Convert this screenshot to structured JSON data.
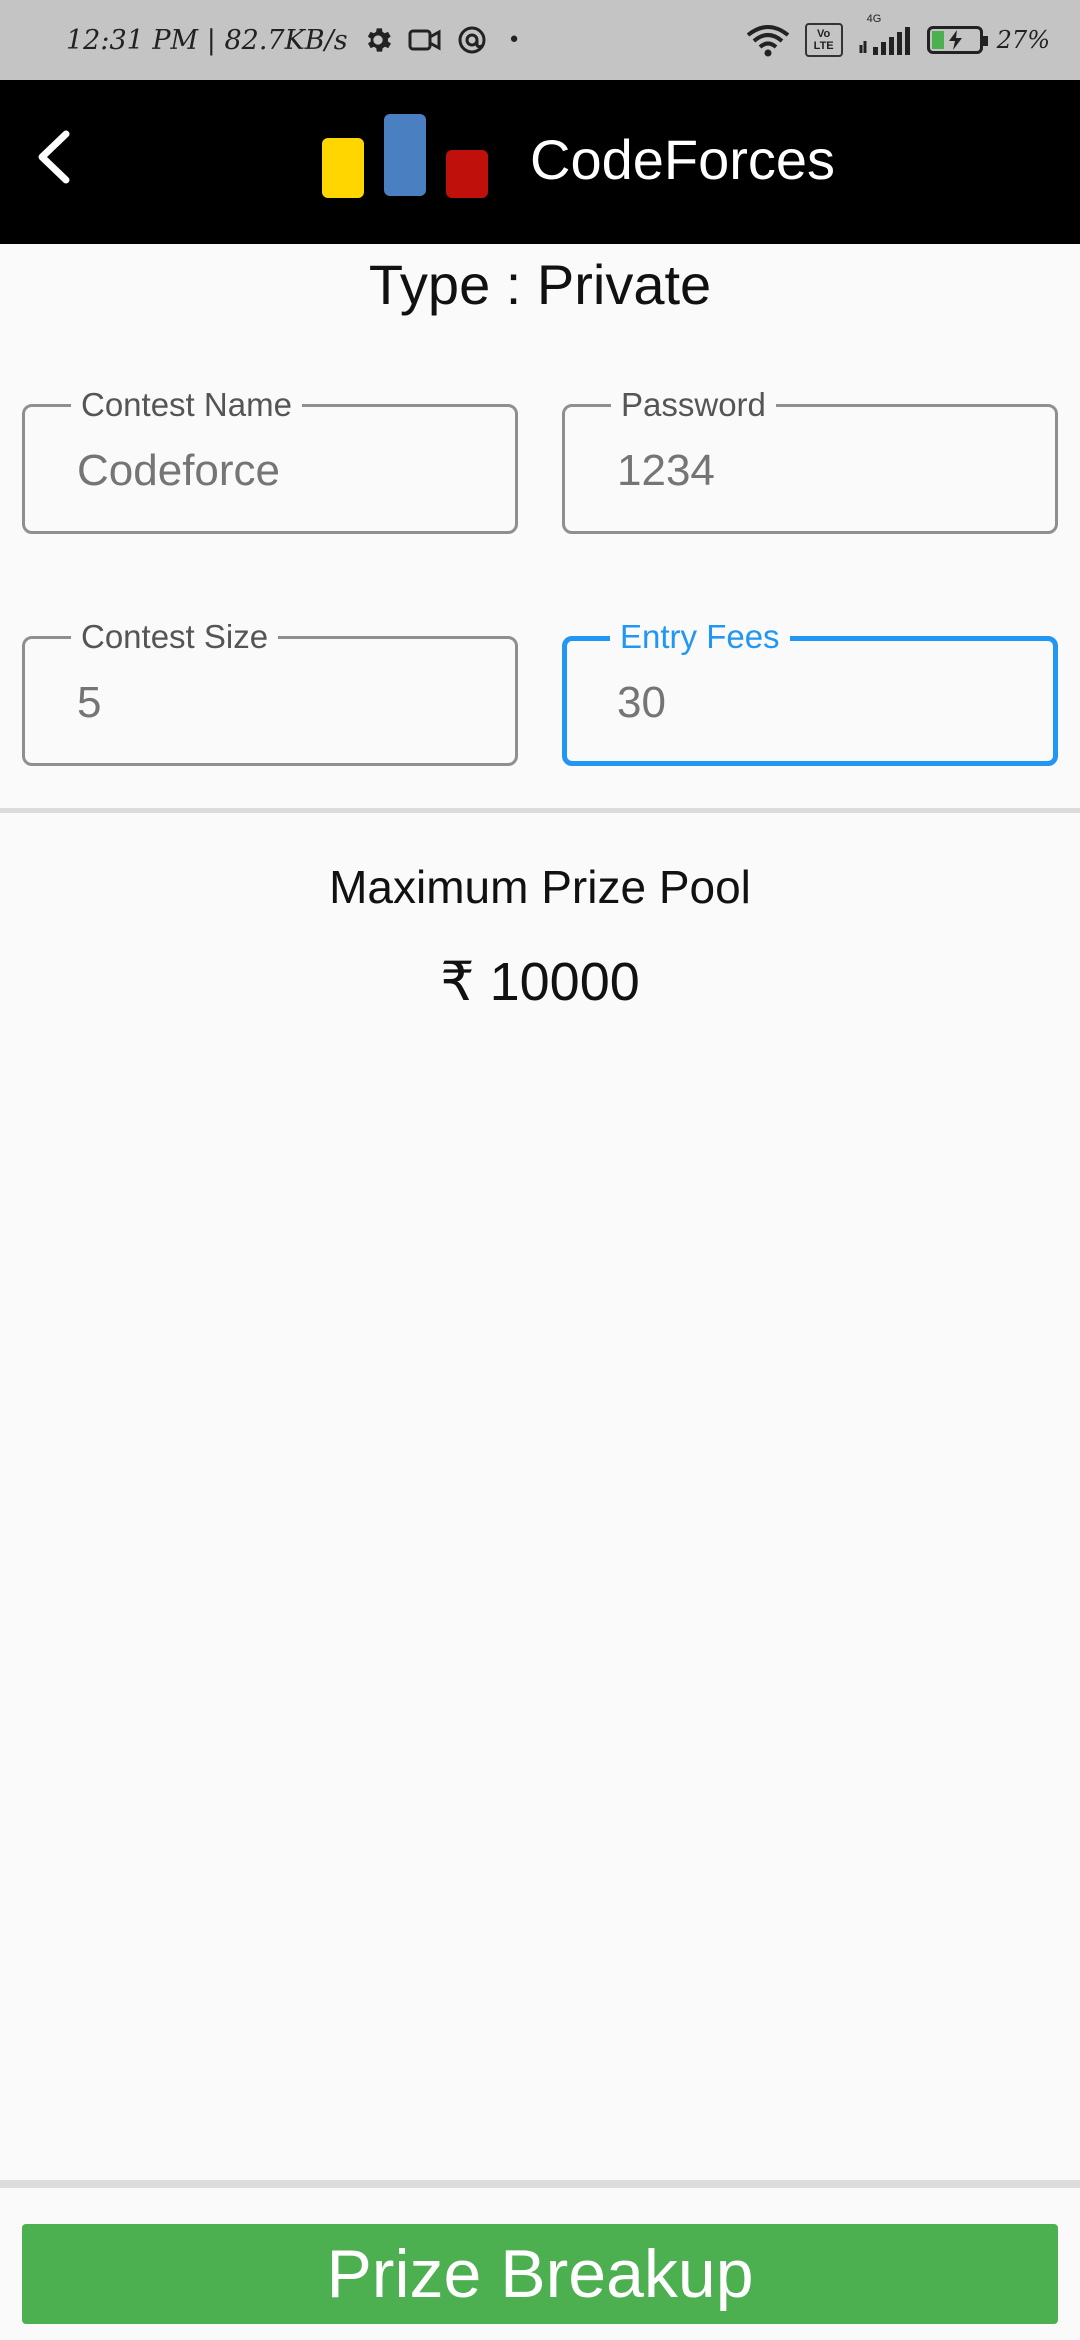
{
  "status_bar": {
    "time_speed": "12:31 PM | 82.7KB/s",
    "dot": "•",
    "volte_top": "Vo",
    "volte_bottom": "LTE",
    "network": "4G",
    "battery_percent": "27%",
    "battery_level": 0.27,
    "battery_color": "#4caf50"
  },
  "app_bar": {
    "title": "CodeForces",
    "back_icon": "chevron-left-icon",
    "logo_colors": [
      "#ffd600",
      "#4a7fc1",
      "#c0100c"
    ]
  },
  "contest": {
    "type_label": "Type : Private",
    "fields": {
      "contest_name": {
        "label": "Contest Name",
        "value": "Codeforce"
      },
      "password": {
        "label": "Password",
        "value": "1234"
      },
      "contest_size": {
        "label": "Contest Size",
        "value": "5"
      },
      "entry_fees": {
        "label": "Entry Fees",
        "value": "30"
      }
    },
    "focused_color": "#2196f3"
  },
  "prize": {
    "title": "Maximum Prize Pool",
    "amount": "₹ 10000",
    "button_label": "Prize Breakup",
    "button_color": "#4caf50"
  }
}
